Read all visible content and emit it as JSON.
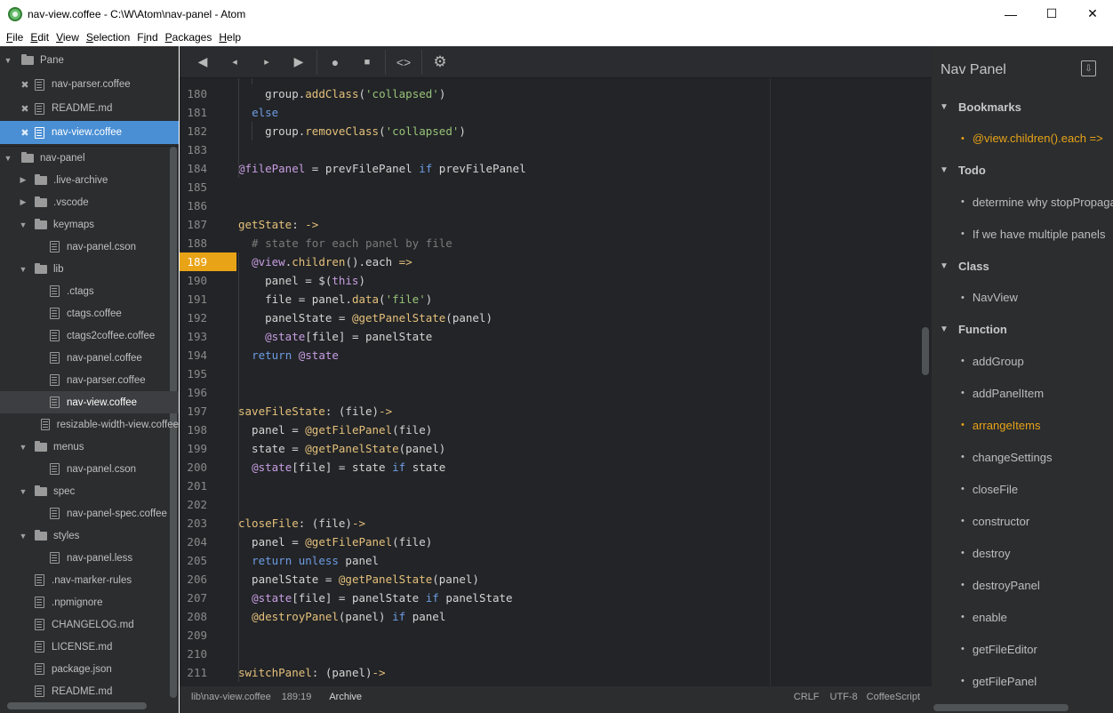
{
  "window": {
    "title": "nav-view.coffee - C:\\W\\Atom\\nav-panel - Atom",
    "minimize": "—",
    "maximize": "☐",
    "close": "✕"
  },
  "menu": [
    {
      "pre": "",
      "u": "F",
      "post": "ile"
    },
    {
      "pre": "",
      "u": "E",
      "post": "dit"
    },
    {
      "pre": "",
      "u": "V",
      "post": "iew"
    },
    {
      "pre": "",
      "u": "S",
      "post": "election"
    },
    {
      "pre": "F",
      "u": "i",
      "post": "nd"
    },
    {
      "pre": "",
      "u": "P",
      "post": "ackages"
    },
    {
      "pre": "",
      "u": "H",
      "post": "elp"
    }
  ],
  "tree": {
    "pane_label": "Pane",
    "open_files": [
      "nav-parser.coffee",
      "README.md",
      "nav-view.coffee"
    ],
    "project": "nav-panel",
    "items": [
      {
        "label": ".live-archive",
        "type": "folder",
        "depth": 1,
        "open": false
      },
      {
        "label": ".vscode",
        "type": "folder",
        "depth": 1,
        "open": false
      },
      {
        "label": "keymaps",
        "type": "folder",
        "depth": 1,
        "open": true
      },
      {
        "label": "nav-panel.cson",
        "type": "file",
        "depth": 2
      },
      {
        "label": "lib",
        "type": "folder",
        "depth": 1,
        "open": true
      },
      {
        "label": ".ctags",
        "type": "file",
        "depth": 2
      },
      {
        "label": "ctags.coffee",
        "type": "file",
        "depth": 2
      },
      {
        "label": "ctags2coffee.coffee",
        "type": "file",
        "depth": 2
      },
      {
        "label": "nav-panel.coffee",
        "type": "file",
        "depth": 2
      },
      {
        "label": "nav-parser.coffee",
        "type": "file",
        "depth": 2
      },
      {
        "label": "nav-view.coffee",
        "type": "file",
        "depth": 2,
        "active": true
      },
      {
        "label": "resizable-width-view.coffee",
        "type": "file",
        "depth": 2
      },
      {
        "label": "menus",
        "type": "folder",
        "depth": 1,
        "open": true
      },
      {
        "label": "nav-panel.cson",
        "type": "file",
        "depth": 2
      },
      {
        "label": "spec",
        "type": "folder",
        "depth": 1,
        "open": true
      },
      {
        "label": "nav-panel-spec.coffee",
        "type": "file",
        "depth": 2
      },
      {
        "label": "styles",
        "type": "folder",
        "depth": 1,
        "open": true
      },
      {
        "label": "nav-panel.less",
        "type": "file",
        "depth": 2
      },
      {
        "label": ".nav-marker-rules",
        "type": "file",
        "depth": 1
      },
      {
        "label": ".npmignore",
        "type": "file",
        "depth": 1
      },
      {
        "label": "CHANGELOG.md",
        "type": "file",
        "depth": 1
      },
      {
        "label": "LICENSE.md",
        "type": "file",
        "depth": 1
      },
      {
        "label": "package.json",
        "type": "file",
        "depth": 1
      },
      {
        "label": "README.md",
        "type": "file",
        "depth": 1
      }
    ]
  },
  "toolbar": {
    "buttons": [
      "arrow-left-icon",
      "chevron-left-icon",
      "chevron-right-icon",
      "arrow-right-icon",
      "map-pin-icon",
      "stop-icon",
      "code-icon",
      "gear-icon"
    ]
  },
  "editor": {
    "current_line": 189,
    "lines": [
      {
        "n": 180,
        "tokens": [
          [
            "    group.",
            ""
          ],
          [
            "addClass",
            "fn"
          ],
          [
            "(",
            ""
          ],
          [
            "'collapsed'",
            "str"
          ],
          [
            ")",
            ""
          ]
        ]
      },
      {
        "n": 181,
        "tokens": [
          [
            "  ",
            ""
          ],
          [
            "else",
            "kw"
          ]
        ]
      },
      {
        "n": 182,
        "tokens": [
          [
            "    group.",
            ""
          ],
          [
            "removeClass",
            "fn"
          ],
          [
            "(",
            ""
          ],
          [
            "'collapsed'",
            "str"
          ],
          [
            ")",
            ""
          ]
        ]
      },
      {
        "n": 183,
        "tokens": []
      },
      {
        "n": 184,
        "tokens": [
          [
            "@filePanel",
            "at"
          ],
          [
            " = prevFilePanel ",
            ""
          ],
          [
            "if",
            "kw"
          ],
          [
            " prevFilePanel",
            ""
          ]
        ]
      },
      {
        "n": 185,
        "tokens": []
      },
      {
        "n": 186,
        "tokens": []
      },
      {
        "n": 187,
        "tokens": [
          [
            "getState",
            "fnname"
          ],
          [
            ": ",
            ""
          ],
          [
            "->",
            "fn"
          ]
        ]
      },
      {
        "n": 188,
        "tokens": [
          [
            "  # state for each panel by file",
            "cm"
          ]
        ]
      },
      {
        "n": 189,
        "tokens": [
          [
            "  ",
            ""
          ],
          [
            "@view",
            "at"
          ],
          [
            ".",
            ""
          ],
          [
            "children",
            "fn"
          ],
          [
            "()",
            ""
          ],
          [
            ".each ",
            ""
          ],
          [
            "=>",
            "fn"
          ]
        ]
      },
      {
        "n": 190,
        "tokens": [
          [
            "    panel = $(",
            ""
          ],
          [
            "this",
            "at"
          ],
          [
            ")",
            ""
          ]
        ]
      },
      {
        "n": 191,
        "tokens": [
          [
            "    file = panel.",
            ""
          ],
          [
            "data",
            "fn"
          ],
          [
            "(",
            ""
          ],
          [
            "'file'",
            "str"
          ],
          [
            ")",
            ""
          ]
        ]
      },
      {
        "n": 192,
        "tokens": [
          [
            "    panelState = ",
            ""
          ],
          [
            "@getPanelState",
            "fn"
          ],
          [
            "(panel)",
            ""
          ]
        ]
      },
      {
        "n": 193,
        "tokens": [
          [
            "    ",
            ""
          ],
          [
            "@state",
            "at"
          ],
          [
            "[file] = panelState",
            ""
          ]
        ]
      },
      {
        "n": 194,
        "tokens": [
          [
            "  ",
            ""
          ],
          [
            "return",
            "kw"
          ],
          [
            " ",
            ""
          ],
          [
            "@state",
            "at"
          ]
        ]
      },
      {
        "n": 195,
        "tokens": []
      },
      {
        "n": 196,
        "tokens": []
      },
      {
        "n": 197,
        "tokens": [
          [
            "saveFileState",
            "fnname"
          ],
          [
            ": (file)",
            ""
          ],
          [
            "->",
            "fn"
          ]
        ]
      },
      {
        "n": 198,
        "tokens": [
          [
            "  panel = ",
            ""
          ],
          [
            "@getFilePanel",
            "fn"
          ],
          [
            "(file)",
            ""
          ]
        ]
      },
      {
        "n": 199,
        "tokens": [
          [
            "  state = ",
            ""
          ],
          [
            "@getPanelState",
            "fn"
          ],
          [
            "(panel)",
            ""
          ]
        ]
      },
      {
        "n": 200,
        "tokens": [
          [
            "  ",
            ""
          ],
          [
            "@state",
            "at"
          ],
          [
            "[file] = state ",
            ""
          ],
          [
            "if",
            "kw"
          ],
          [
            " state",
            ""
          ]
        ]
      },
      {
        "n": 201,
        "tokens": []
      },
      {
        "n": 202,
        "tokens": []
      },
      {
        "n": 203,
        "tokens": [
          [
            "closeFile",
            "fnname"
          ],
          [
            ": (file)",
            ""
          ],
          [
            "->",
            "fn"
          ]
        ]
      },
      {
        "n": 204,
        "tokens": [
          [
            "  panel = ",
            ""
          ],
          [
            "@getFilePanel",
            "fn"
          ],
          [
            "(file)",
            ""
          ]
        ]
      },
      {
        "n": 205,
        "tokens": [
          [
            "  ",
            ""
          ],
          [
            "return",
            "kw"
          ],
          [
            " ",
            ""
          ],
          [
            "unless",
            "kw"
          ],
          [
            " panel",
            ""
          ]
        ]
      },
      {
        "n": 206,
        "tokens": [
          [
            "  panelState = ",
            ""
          ],
          [
            "@getPanelState",
            "fn"
          ],
          [
            "(panel)",
            ""
          ]
        ]
      },
      {
        "n": 207,
        "tokens": [
          [
            "  ",
            ""
          ],
          [
            "@state",
            "at"
          ],
          [
            "[file] = panelState ",
            ""
          ],
          [
            "if",
            "kw"
          ],
          [
            " panelState",
            ""
          ]
        ]
      },
      {
        "n": 208,
        "tokens": [
          [
            "  ",
            ""
          ],
          [
            "@destroyPanel",
            "fn"
          ],
          [
            "(panel) ",
            ""
          ],
          [
            "if",
            "kw"
          ],
          [
            " panel",
            ""
          ]
        ]
      },
      {
        "n": 209,
        "tokens": []
      },
      {
        "n": 210,
        "tokens": []
      },
      {
        "n": 211,
        "tokens": [
          [
            "switchPanel",
            "fnname"
          ],
          [
            ": (panel)",
            ""
          ],
          [
            "->",
            "fn"
          ]
        ]
      }
    ]
  },
  "status": {
    "path": "lib\\nav-view.coffee",
    "cursor": "189:19",
    "archive": "Archive",
    "line_ending": "CRLF",
    "encoding": "UTF-8",
    "grammar": "CoffeeScript"
  },
  "nav_panel": {
    "title": "Nav Panel",
    "groups": [
      {
        "label": "Bookmarks",
        "items": [
          {
            "label": "@view.children().each =>",
            "hl": true
          }
        ]
      },
      {
        "label": "Todo",
        "items": [
          {
            "label": "determine why stopPropagation doesn't work"
          },
          {
            "label": "If we have multiple panels"
          }
        ]
      },
      {
        "label": "Class",
        "items": [
          {
            "label": "NavView"
          }
        ]
      },
      {
        "label": "Function",
        "items": [
          {
            "label": "addGroup"
          },
          {
            "label": "addPanelItem"
          },
          {
            "label": "arrangeItems",
            "hl": true
          },
          {
            "label": "changeSettings"
          },
          {
            "label": "closeFile"
          },
          {
            "label": "constructor"
          },
          {
            "label": "destroy"
          },
          {
            "label": "destroyPanel"
          },
          {
            "label": "enable"
          },
          {
            "label": "getFileEditor"
          },
          {
            "label": "getFilePanel"
          }
        ]
      }
    ]
  },
  "colors": {
    "accent": "#4a8fd4",
    "highlight": "#e8a317"
  }
}
